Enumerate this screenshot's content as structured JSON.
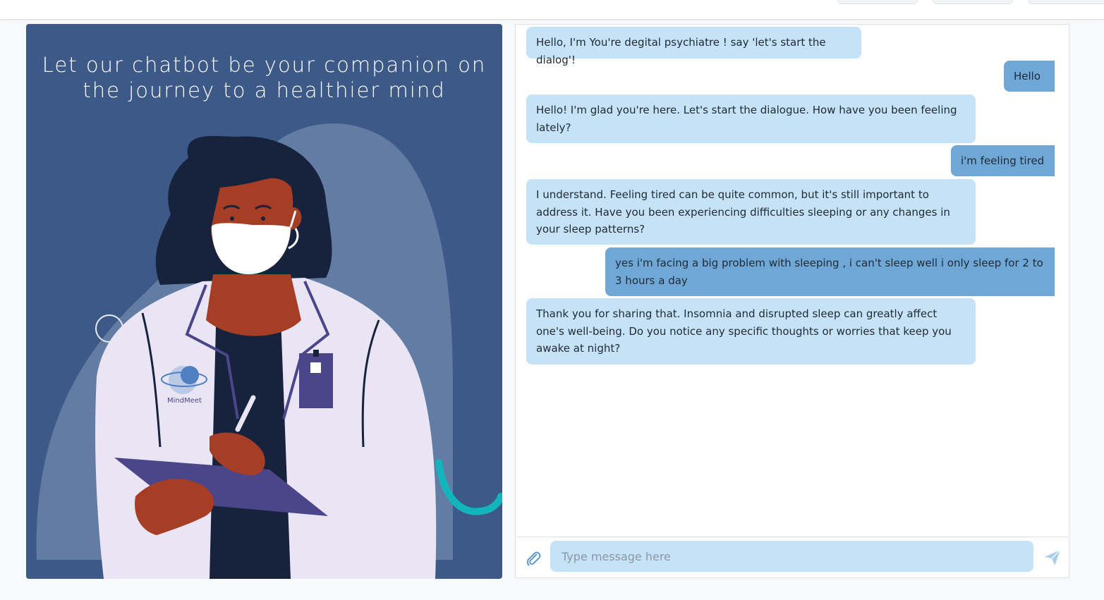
{
  "hero": {
    "title": "Let our chatbot be your companion on\nthe journey to a healthier mind",
    "logo_text": "MindMeet"
  },
  "chat": {
    "messages": [
      {
        "role": "bot",
        "text": "Hello, I'm You're degital psychiatre ! say 'let's start the dialog'!"
      },
      {
        "role": "user",
        "text": "Hello"
      },
      {
        "role": "bot",
        "text": "Hello! I'm glad you're here. Let's start the dialogue. How have you been feeling lately?"
      },
      {
        "role": "user",
        "text": "i'm feeling tired"
      },
      {
        "role": "bot",
        "text": "I understand. Feeling tired can be quite common, but it's still important to address it. Have you been experiencing difficulties sleeping or any changes in your sleep patterns?"
      },
      {
        "role": "user",
        "text": "yes i'm facing a big problem with sleeping , i can't sleep well i only sleep for 2 to 3 hours a day"
      },
      {
        "role": "bot",
        "text": "Thank you for sharing that. Insomnia and disrupted sleep can greatly affect one's well-being. Do you notice any specific thoughts or worries that keep you awake at night?"
      }
    ]
  },
  "composer": {
    "placeholder": "Type message here",
    "attach_icon": "paperclip-icon",
    "send_icon": "send-icon"
  },
  "colors": {
    "hero_bg": "#3c5987",
    "bot_bubble": "#c6e2f7",
    "user_bubble": "#6fa8d6",
    "accent_teal": "#13b5bd"
  }
}
